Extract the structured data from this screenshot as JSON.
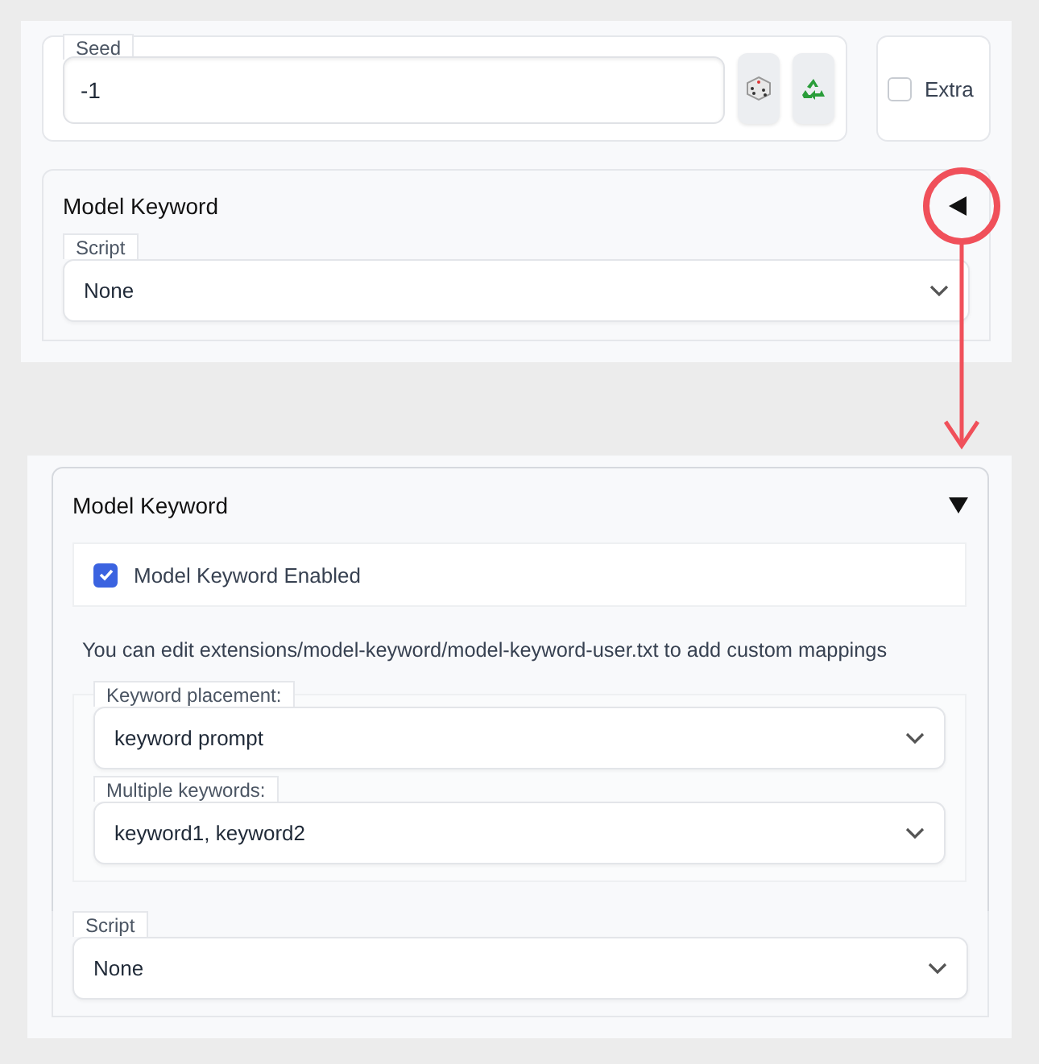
{
  "before": {
    "seed": {
      "label": "Seed",
      "value": "-1"
    },
    "extra": {
      "label": "Extra",
      "checked": false
    },
    "accordion": {
      "title": "Model Keyword",
      "expanded": false
    },
    "script": {
      "label": "Script",
      "value": "None"
    }
  },
  "after": {
    "accordion": {
      "title": "Model Keyword",
      "expanded": true,
      "enabled": {
        "label": "Model Keyword Enabled",
        "checked": true
      },
      "note": "You can edit extensions/model-keyword/model-keyword-user.txt to add custom mappings",
      "dropdowns": [
        {
          "label": "Keyword placement:",
          "value": "keyword prompt"
        },
        {
          "label": "Multiple keywords:",
          "value": "keyword1, keyword2"
        }
      ]
    },
    "script": {
      "label": "Script",
      "value": "None"
    }
  }
}
